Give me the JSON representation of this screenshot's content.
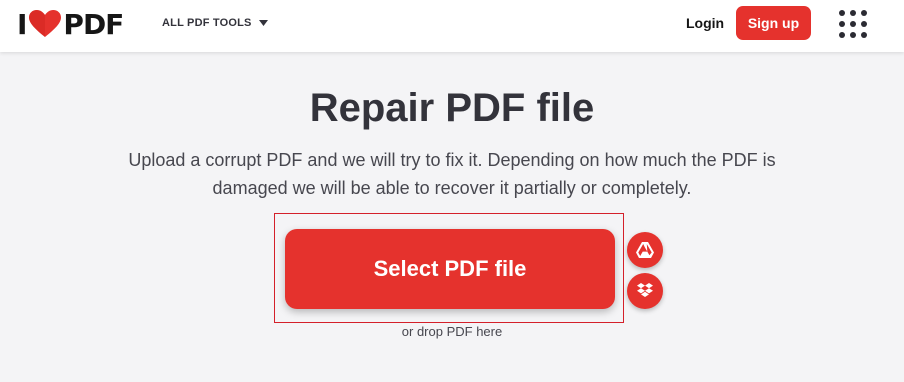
{
  "brand": {
    "logo_left": "I",
    "logo_right": "PDF",
    "accent_color": "#e5322d"
  },
  "nav": {
    "tools_label": "ALL PDF TOOLS",
    "login_label": "Login",
    "signup_label": "Sign up"
  },
  "main": {
    "title": "Repair PDF file",
    "subtitle_line1": "Upload a corrupt PDF and we will try to fix it. Depending on how much the PDF is",
    "subtitle_line2": "damaged we will be able to recover it partially or completely.",
    "select_label": "Select PDF file",
    "drop_hint": "or drop PDF here"
  },
  "icons": {
    "heart": "heart-icon",
    "caret": "chevron-down-icon",
    "apps": "apps-grid-icon",
    "gdrive": "google-drive-icon",
    "dropbox": "dropbox-icon"
  }
}
